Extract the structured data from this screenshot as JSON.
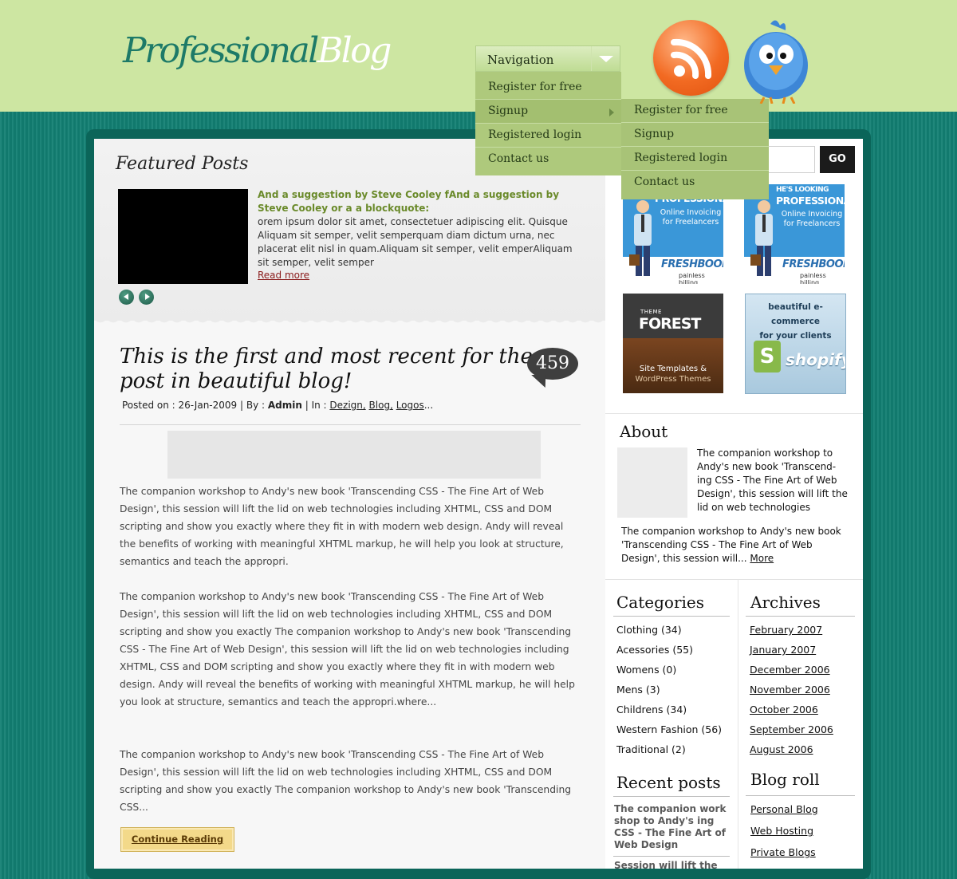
{
  "logo": {
    "part1": "Professional",
    "part2": "Blog"
  },
  "navigation": {
    "label": "Navigation",
    "menu": [
      "Register for free",
      "Signup",
      "Registered login",
      "Contact us"
    ],
    "submenu": [
      "Register for free",
      "Signup",
      "Registered login",
      "Contact us"
    ]
  },
  "icons": {
    "rss": "rss-icon",
    "twitter": "twitter-bird-icon"
  },
  "colors": {
    "header": "#cde6a2",
    "background": "#128073",
    "menu": "#aec97c",
    "accent_green": "#6a8a2a"
  },
  "featured": {
    "heading": "Featured Posts",
    "title": "And a suggestion by Steve Cooley fAnd a suggestion by Steve Cooley or a a blockquote:",
    "text": "orem ipsum dolor sit amet, consectetuer adipiscing elit. Quisque Aliquam sit semper, velit semperquam diam dictum urna, nec placerat elit nisl in quam.Aliquam sit semper, velit emperAliquam sit semper, velit semper",
    "read_more": "Read more"
  },
  "post": {
    "title": "This is the first and most recent for the post in beautiful blog!",
    "comments": "459",
    "meta": {
      "posted_label": "Posted on : 26-Jan-2009 | By : ",
      "author": "Admin",
      "in_label": " | In : ",
      "tags": [
        "Dezign,",
        "Blog,",
        "Logos"
      ],
      "ellipsis": "..."
    },
    "paragraphs": [
      "The companion workshop to Andy's new book 'Transcending CSS - The Fine Art of Web Design', this session will lift the lid on web technologies including XHTML, CSS and DOM scripting and show you exactly where they fit in with modern web design. Andy will reveal the benefits of working with meaningful XHTML markup, he will help you look at structure, semantics and teach the appropri.",
      "The companion workshop to Andy's new book 'Transcending CSS - The Fine Art of Web Design', this session will lift the lid on web technologies including XHTML, CSS and DOM scripting and show you exactly The companion workshop to Andy's new book 'Transcending CSS - The Fine Art of Web Design', this session will lift the lid on web technologies including XHTML, CSS and DOM scripting and show you exactly where they fit in with modern web design. Andy will reveal the benefits of working with meaningful XHTML markup, he will help you look at structure, semantics and teach the appropri.where...",
      "The companion workshop to Andy's new book 'Transcending CSS - The Fine Art of Web Design', this session will lift the lid on web technologies including XHTML, CSS and DOM scripting and show you exactly The companion workshop to Andy's new book 'Transcending CSS..."
    ],
    "continue_label": "Continue Reading"
  },
  "search": {
    "button": "GO",
    "placeholder": ""
  },
  "ads": {
    "freshbooks": {
      "headline": "HE'S LOOKING",
      "brand_line": "PROFESSIONAL",
      "subtitle": "Online Invoicing for Freelancers",
      "brand": "FRESHBOOKS",
      "tagline": "painless billing"
    },
    "themeforest": {
      "small": "THEME",
      "brand": "FOREST",
      "line1": "Site Templates &",
      "line2": "WordPress Themes"
    },
    "shopify": {
      "line1": "beautiful e-commerce",
      "line2": "for your clients",
      "brand": "shopify",
      "bag_letter": "S"
    }
  },
  "about": {
    "heading": "About",
    "text1": "The companion workshop to Andy's new book 'Transcend-ing CSS - The Fine Art of Web Design', this session will lift the lid on web technologies",
    "text2": "The companion workshop to Andy's new book 'Transcending CSS - The Fine Art of Web Design', this session will... ",
    "more": "More"
  },
  "categories": {
    "heading": "Categories",
    "items": [
      "Clothing (34)",
      "Acessories (55)",
      "Womens (0)",
      "Mens (3)",
      "Childrens (34)",
      "Western Fashion (56)",
      "Traditional (2)"
    ]
  },
  "archives": {
    "heading": "Archives",
    "items": [
      "February 2007",
      "January 2007",
      "December 2006",
      "November 2006",
      "October 2006",
      "September 2006",
      "August 2006"
    ]
  },
  "recent_posts": {
    "heading": "Recent posts",
    "items": [
      "The companion work shop to Andy's ing CSS - The Fine Art of Web Design",
      "Session will lift the"
    ]
  },
  "blog_roll": {
    "heading": "Blog roll",
    "items": [
      "Personal Blog",
      "Web Hosting",
      "Private Blogs"
    ]
  }
}
